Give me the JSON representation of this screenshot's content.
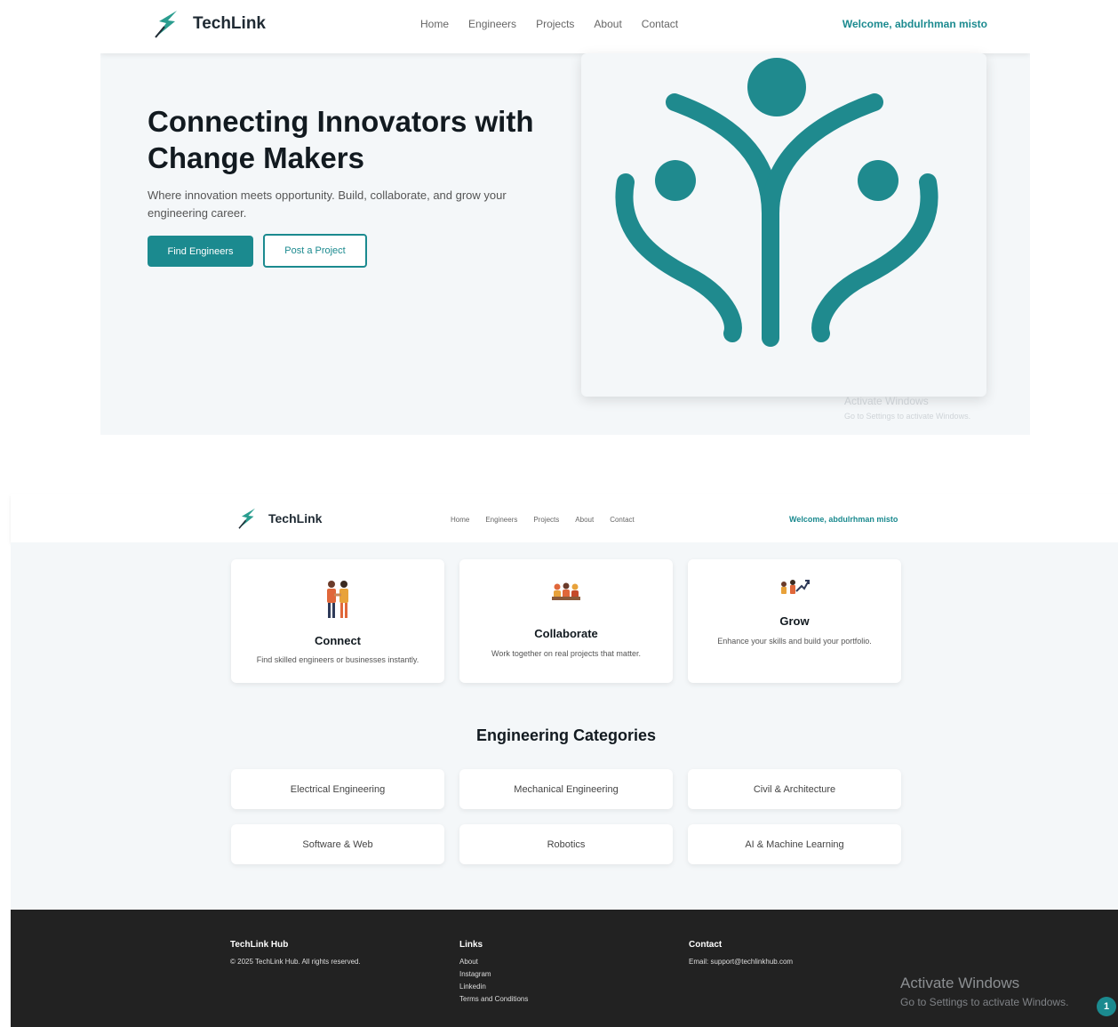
{
  "brand": {
    "name": "TechLink"
  },
  "nav": {
    "links": [
      "Home",
      "Engineers",
      "Projects",
      "About",
      "Contact"
    ],
    "welcome": "Welcome, abdulrhman misto"
  },
  "hero": {
    "title": "Connecting Innovators with Change Makers",
    "subtitle": "Where innovation meets opportunity. Build, collaborate, and grow your engineering career.",
    "primary_button": "Find Engineers",
    "secondary_button": "Post a Project",
    "illustration_icon": "people-tree-icon"
  },
  "features": [
    {
      "title": "Connect",
      "desc": "Find skilled engineers or businesses instantly.",
      "icon": "handshake-people-icon"
    },
    {
      "title": "Collaborate",
      "desc": "Work together on real projects that matter.",
      "icon": "team-collaborate-icon"
    },
    {
      "title": "Grow",
      "desc": "Enhance your skills and build your portfolio.",
      "icon": "growth-chart-icon"
    }
  ],
  "categories": {
    "title": "Engineering Categories",
    "items": [
      "Electrical Engineering",
      "Mechanical Engineering",
      "Civil & Architecture",
      "Software & Web",
      "Robotics",
      "AI & Machine Learning"
    ]
  },
  "footer": {
    "hub_title": "TechLink Hub",
    "copyright": "© 2025 TechLink Hub. All rights reserved.",
    "links_title": "Links",
    "links": [
      "About",
      "Instagram",
      "Linkedin",
      "Terms and Conditions"
    ],
    "contact_title": "Contact",
    "contact_email": "Email: support@techlinkhub.com"
  },
  "watermark": {
    "title": "Activate Windows",
    "subtitle": "Go to Settings to activate Windows."
  },
  "colors": {
    "accent": "#1b8a8f",
    "background": "#f4f7f9",
    "footer": "#222222"
  }
}
